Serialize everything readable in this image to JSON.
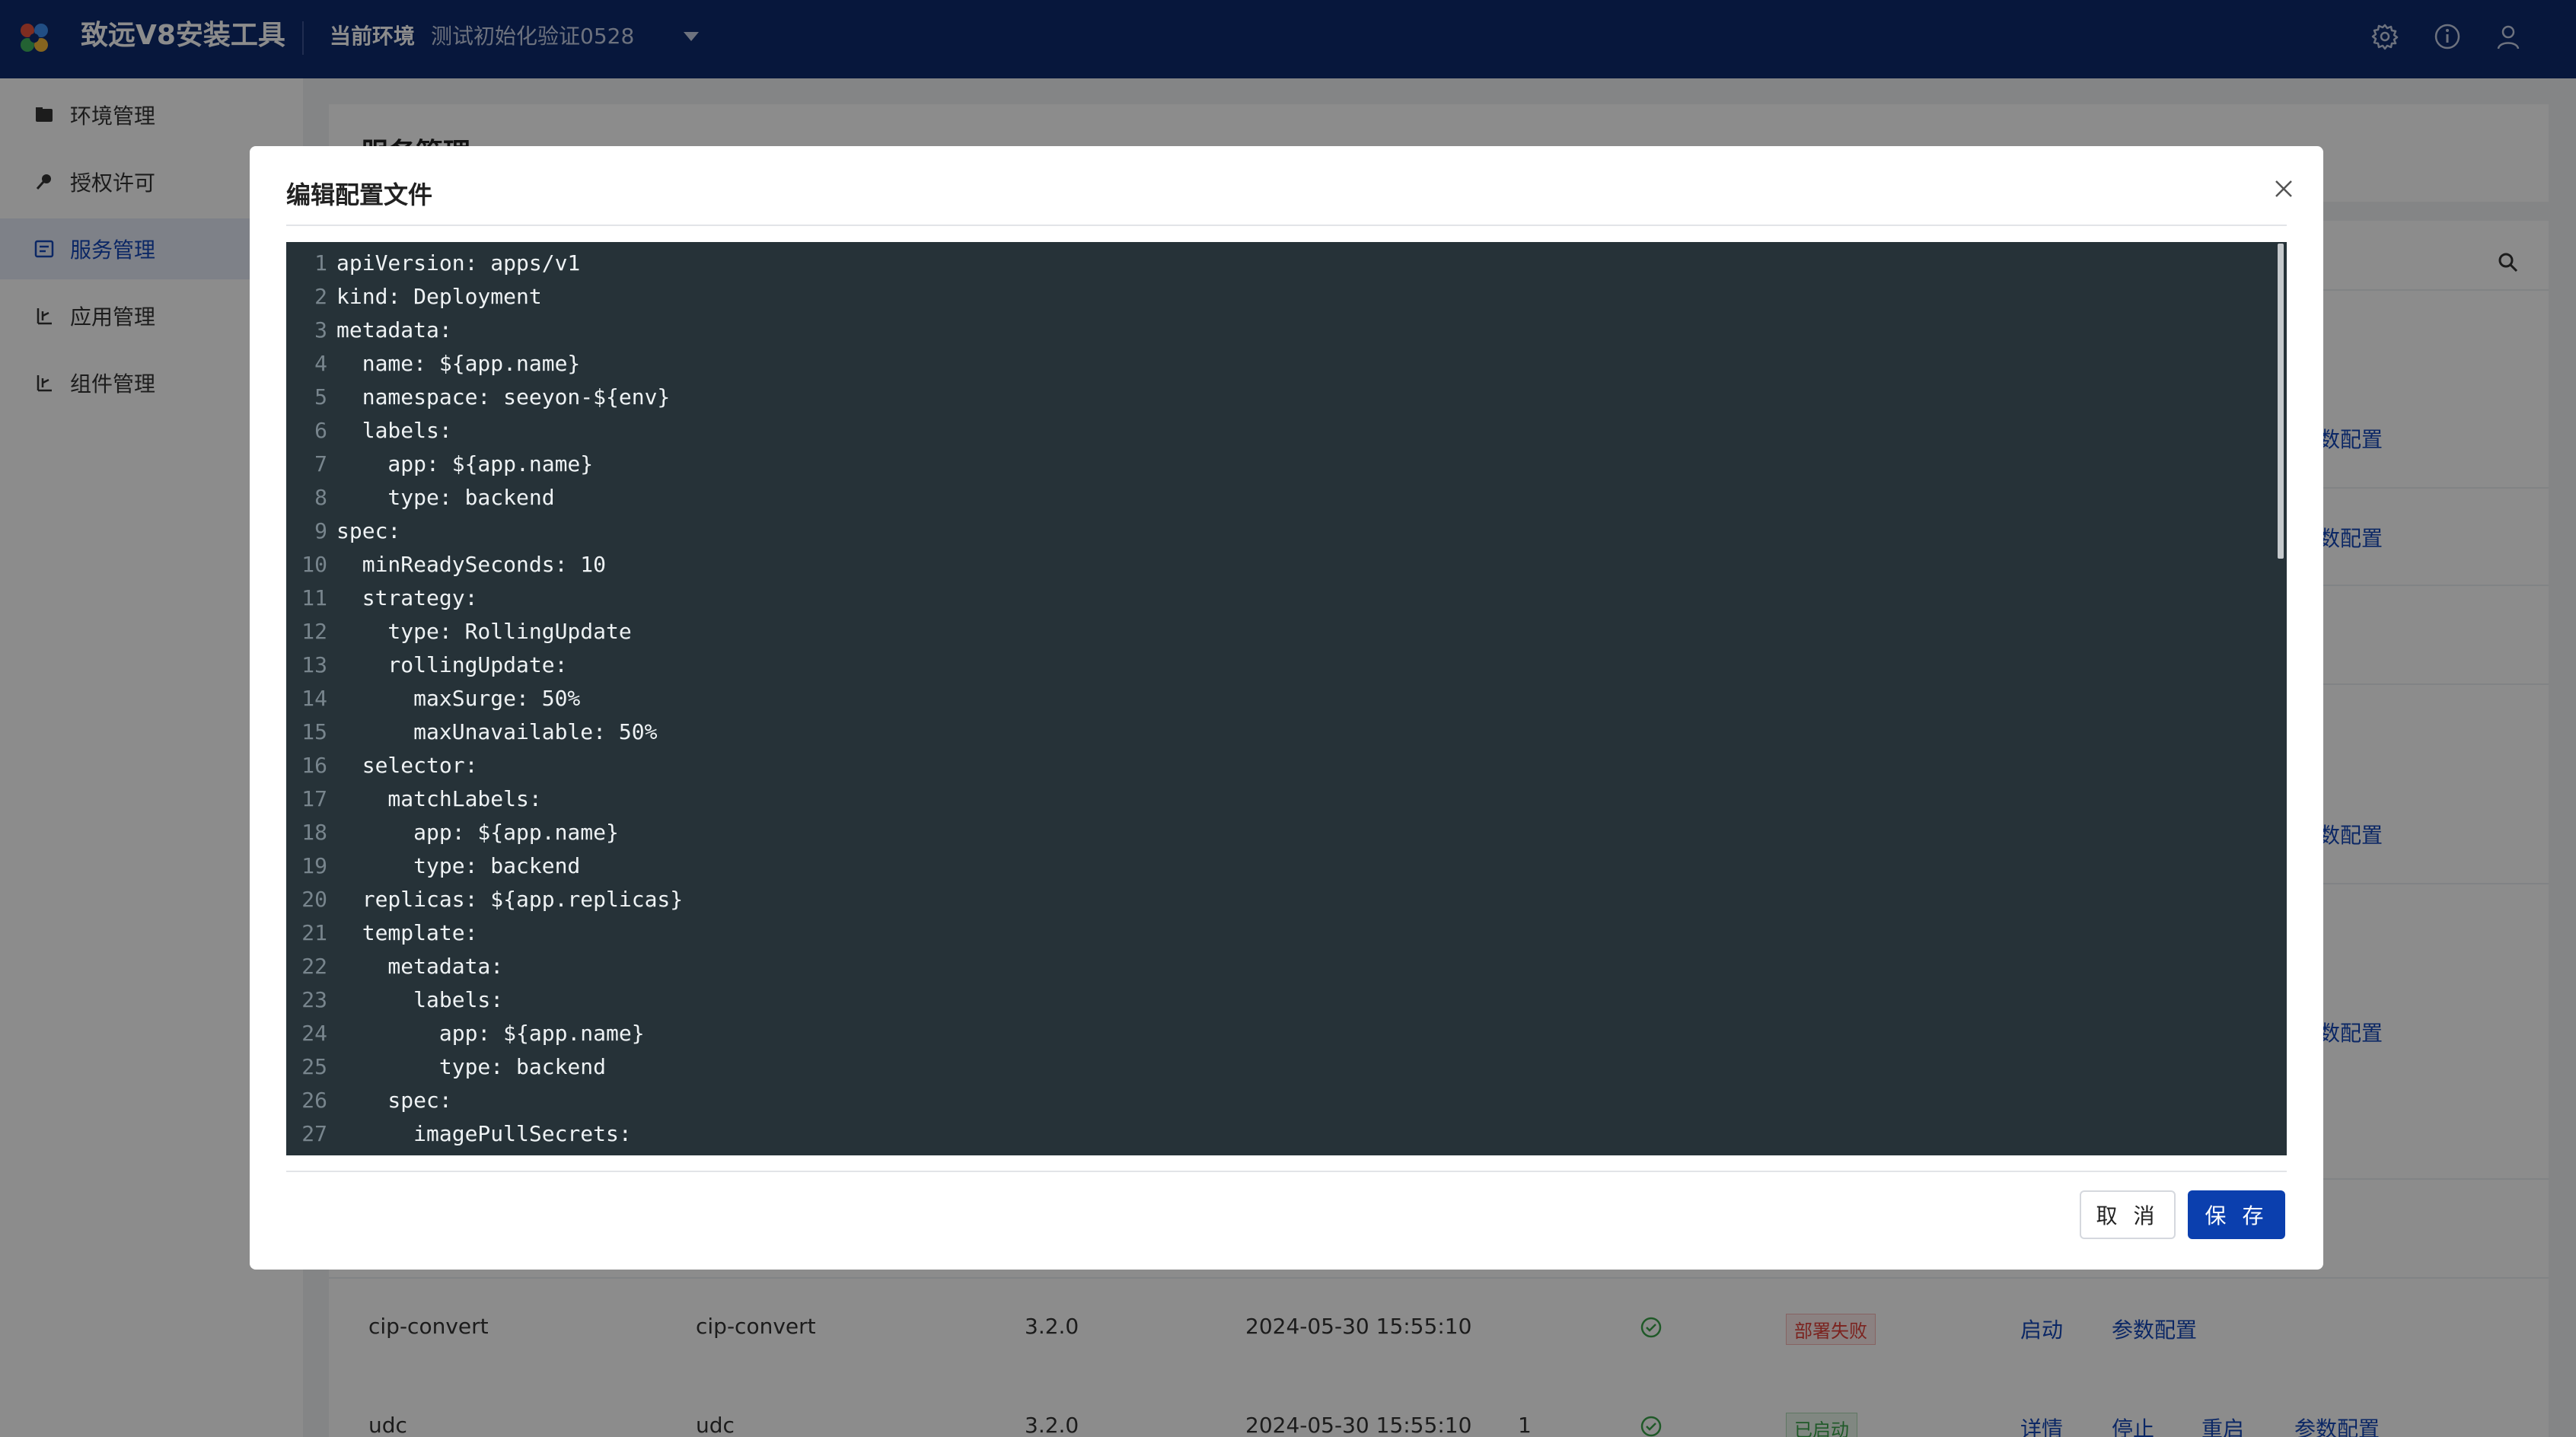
{
  "header": {
    "app_title": "致远V8安装工具",
    "env_label": "当前环境",
    "env_value": "测试初始化验证0528",
    "icons": [
      "settings-icon",
      "info-icon",
      "user-icon"
    ]
  },
  "sidebar": {
    "items": [
      {
        "label": "环境管理",
        "icon": "folder-icon",
        "active": false
      },
      {
        "label": "授权许可",
        "icon": "key-icon",
        "active": false
      },
      {
        "label": "服务管理",
        "icon": "service-icon",
        "active": true
      },
      {
        "label": "应用管理",
        "icon": "app-icon",
        "active": false
      },
      {
        "label": "组件管理",
        "icon": "component-icon",
        "active": false
      }
    ]
  },
  "main": {
    "title": "服务管理",
    "partial_links": [
      "数配置",
      "数配置",
      "数配置",
      "数配置"
    ],
    "rows": [
      {
        "name": "cip-convert",
        "code": "cip-convert",
        "version": "3.2.0",
        "time": "2024-05-30 15:55:10",
        "count": "",
        "status": "部署失败",
        "actions": [
          "启动",
          "参数配置"
        ]
      },
      {
        "name": "udc",
        "code": "udc",
        "version": "3.2.0",
        "time": "2024-05-30 15:55:10",
        "count": "1",
        "status": "已启动",
        "actions": [
          "详情",
          "停止",
          "重启",
          "参数配置"
        ]
      }
    ]
  },
  "modal": {
    "title": "编辑配置文件",
    "cancel_label": "取 消",
    "save_label": "保 存",
    "code_lines": [
      {
        "n": "1",
        "text": "apiVersion: apps/v1"
      },
      {
        "n": "2",
        "text": "kind: Deployment"
      },
      {
        "n": "3",
        "text": "metadata:"
      },
      {
        "n": "4",
        "text": "  name: ${app.name}"
      },
      {
        "n": "5",
        "text": "  namespace: seeyon-${env}"
      },
      {
        "n": "6",
        "text": "  labels:"
      },
      {
        "n": "7",
        "text": "    app: ${app.name}"
      },
      {
        "n": "8",
        "text": "    type: backend"
      },
      {
        "n": "9",
        "text": "spec:"
      },
      {
        "n": "10",
        "text": "  minReadySeconds: 10"
      },
      {
        "n": "11",
        "text": "  strategy:"
      },
      {
        "n": "12",
        "text": "    type: RollingUpdate"
      },
      {
        "n": "13",
        "text": "    rollingUpdate:"
      },
      {
        "n": "14",
        "text": "      maxSurge: 50%"
      },
      {
        "n": "15",
        "text": "      maxUnavailable: 50%"
      },
      {
        "n": "16",
        "text": "  selector:"
      },
      {
        "n": "17",
        "text": "    matchLabels:"
      },
      {
        "n": "18",
        "text": "      app: ${app.name}"
      },
      {
        "n": "19",
        "text": "      type: backend"
      },
      {
        "n": "20",
        "text": "  replicas: ${app.replicas}"
      },
      {
        "n": "21",
        "text": "  template:"
      },
      {
        "n": "22",
        "text": "    metadata:"
      },
      {
        "n": "23",
        "text": "      labels:"
      },
      {
        "n": "24",
        "text": "        app: ${app.name}"
      },
      {
        "n": "25",
        "text": "        type: backend"
      },
      {
        "n": "26",
        "text": "    spec:"
      },
      {
        "n": "27",
        "text": "      imagePullSecrets:"
      }
    ]
  },
  "colors": {
    "header_bg": "#0e2a6e",
    "accent": "#1547b8",
    "primary_button": "#0b3fae",
    "editor_bg": "#263238"
  }
}
